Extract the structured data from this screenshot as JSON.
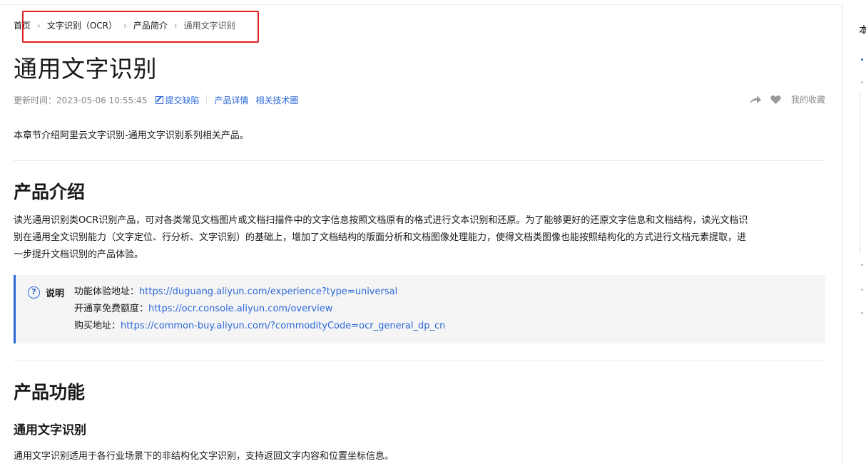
{
  "breadcrumb": {
    "home": "首页",
    "ocr": "文字识别（OCR）",
    "intro": "产品简介",
    "current": "通用文字识别",
    "separator": "›"
  },
  "page": {
    "title": "通用文字识别",
    "updated": "更新时间：2023-05-06 10:55:45",
    "submit_bug": "提交缺陷",
    "product_detail": "产品详情",
    "tech_circle": "相关技术圈",
    "favorites": "我的收藏"
  },
  "content": {
    "intro": "本章节介绍阿里云文字识别-通用文字识别系列相关产品。",
    "section1_title": "产品介绍",
    "section1_lines": [
      "读光通用识别类OCR识别产品，可对各类常见文档图片或文档扫描件中的文字信息按照文档原有的格式进行文本识别和还原。为了能够更好的还原文字信息和文档结构，读光文档识",
      "别在通用全文识别能力（文字定位、行分析、文字识别）的基础上，增加了文档结构的版面分析和文档图像处理能力，使得文档类图像也能按照结构化的方式进行文档元素提取，进",
      "一步提升文档识别的产品体验。"
    ],
    "note": {
      "label": "说明",
      "rows": [
        {
          "key": "功能体验地址：",
          "value": "https://duguang.aliyun.com/experience?type=universal"
        },
        {
          "key": "开通享免费额度：",
          "value": "https://ocr.console.aliyun.com/overview"
        },
        {
          "key": "购买地址：",
          "value": "https://common-buy.aliyun.com/?commodityCode=ocr_general_dp_cn"
        }
      ]
    },
    "section2_title": "产品功能",
    "subsection_title": "通用文字识别",
    "subsection_text": "通用文字识别适用于各行业场景下的非结构化文字识别，支持返回文字内容和位置坐标信息。"
  },
  "toc": {
    "title": "本"
  },
  "colors": {
    "link": "#2a67d8",
    "highlight_border": "#e02020",
    "note_bg": "#f5f5f6"
  },
  "icons": [
    "edit-icon",
    "share-icon",
    "heart-icon",
    "question-icon"
  ]
}
